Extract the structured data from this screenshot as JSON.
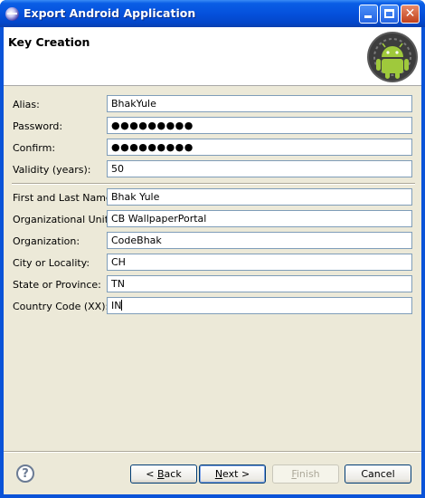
{
  "window": {
    "title": "Export Android Application"
  },
  "header": {
    "title": "Key Creation"
  },
  "form": {
    "key": [
      {
        "label": "Alias:",
        "value": "BhakYule",
        "type": "text"
      },
      {
        "label": "Password:",
        "value": "●●●●●●●●●",
        "type": "password"
      },
      {
        "label": "Confirm:",
        "value": "●●●●●●●●●",
        "type": "password"
      },
      {
        "label": "Validity (years):",
        "value": "50",
        "type": "text"
      }
    ],
    "identity": [
      {
        "label": "First and Last Name:",
        "value": "Bhak Yule"
      },
      {
        "label": "Organizational Unit:",
        "value": "CB WallpaperPortal"
      },
      {
        "label": "Organization:",
        "value": "CodeBhak"
      },
      {
        "label": "City or Locality:",
        "value": "CH"
      },
      {
        "label": "State or Province:",
        "value": "TN"
      },
      {
        "label": "Country Code (XX):",
        "value": "IN"
      }
    ]
  },
  "buttons": {
    "help": "?",
    "back_mnemonic": "B",
    "back_rest": "ack",
    "back_prefix": "< ",
    "next_mnemonic": "N",
    "next_rest": "ext >",
    "finish_mnemonic": "F",
    "finish_rest": "inish",
    "cancel": "Cancel"
  },
  "titlebar_buttons": {
    "close_glyph": "✕"
  },
  "colors": {
    "titlebar": "#0551dc",
    "dialog_bg": "#ece9d8",
    "field_border": "#7f9db9",
    "android_green": "#9fc93c"
  }
}
